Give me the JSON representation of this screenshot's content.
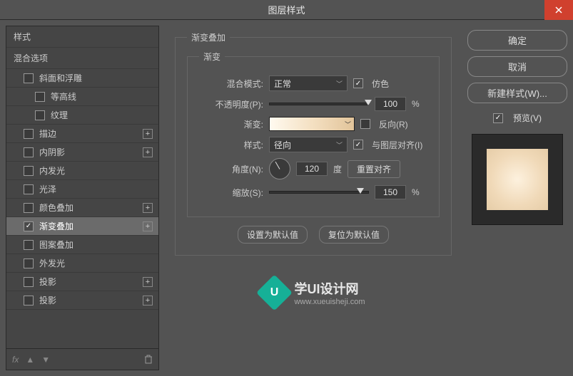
{
  "window": {
    "title": "图层样式"
  },
  "left": {
    "styles_header": "样式",
    "blend_options": "混合选项",
    "items": [
      {
        "label": "斜面和浮雕",
        "checked": false,
        "plus": false,
        "indent": 1
      },
      {
        "label": "等高线",
        "checked": false,
        "plus": false,
        "indent": 2
      },
      {
        "label": "纹理",
        "checked": false,
        "plus": false,
        "indent": 2
      },
      {
        "label": "描边",
        "checked": false,
        "plus": true,
        "indent": 1
      },
      {
        "label": "内阴影",
        "checked": false,
        "plus": true,
        "indent": 1
      },
      {
        "label": "内发光",
        "checked": false,
        "plus": false,
        "indent": 1
      },
      {
        "label": "光泽",
        "checked": false,
        "plus": false,
        "indent": 1
      },
      {
        "label": "颜色叠加",
        "checked": false,
        "plus": true,
        "indent": 1
      },
      {
        "label": "渐变叠加",
        "checked": true,
        "plus": true,
        "indent": 1,
        "selected": true
      },
      {
        "label": "图案叠加",
        "checked": false,
        "plus": false,
        "indent": 1
      },
      {
        "label": "外发光",
        "checked": false,
        "plus": false,
        "indent": 1
      },
      {
        "label": "投影",
        "checked": false,
        "plus": true,
        "indent": 1
      },
      {
        "label": "投影",
        "checked": false,
        "plus": true,
        "indent": 1
      }
    ],
    "footer_fx": "fx"
  },
  "middle": {
    "fieldset_title": "渐变叠加",
    "inner_title": "渐变",
    "labels": {
      "blendmode": "混合模式:",
      "opacity": "不透明度(P):",
      "gradient": "渐变:",
      "style": "样式:",
      "angle": "角度(N):",
      "scale": "缩放(S):"
    },
    "values": {
      "blendmode": "正常",
      "dither": "仿色",
      "opacity": "100",
      "opacity_unit": "%",
      "reverse": "反向(R)",
      "style": "径向",
      "align": "与图层对齐(I)",
      "angle": "120",
      "angle_unit": "度",
      "reset_align": "重置对齐",
      "scale": "150",
      "scale_unit": "%"
    },
    "buttons": {
      "set_default": "设置为默认值",
      "reset_default": "复位为默认值"
    },
    "watermark": {
      "title": "学UI设计网",
      "url": "www.xueuisheji.com"
    }
  },
  "right": {
    "ok": "确定",
    "cancel": "取消",
    "new_style": "新建样式(W)...",
    "preview": "预览(V)"
  }
}
